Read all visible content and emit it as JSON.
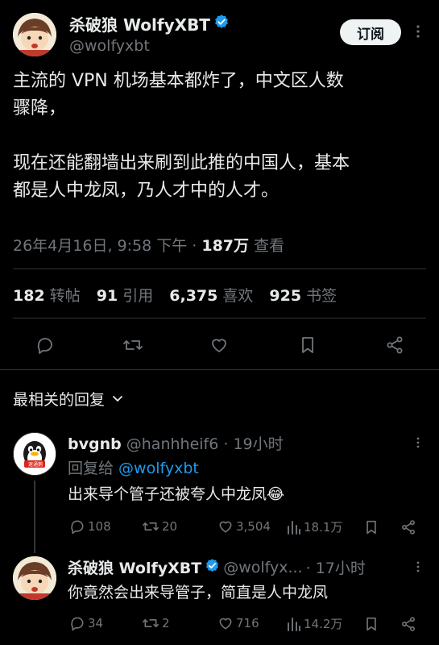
{
  "tweet": {
    "display_name": "杀破狼 WolfyXBT",
    "handle": "@wolfyxbt",
    "subscribe_label": "订阅",
    "more_icon": "more-dots-icon",
    "text_line1": "主流的 VPN 机场基本都炸了，中文区人数",
    "text_line2": "骤降，",
    "text_line3": "现在还能翻墙出来刷到此推的中国人，基本",
    "text_line4": "都是人中龙凤，乃人才中的人才。",
    "meta_time": "26年4月16日, 9:58 下午 · ",
    "meta_views": "187万",
    "meta_views_label": " 查看",
    "stats": {
      "retweets": "182",
      "retweets_label": "转帖",
      "quotes": "91",
      "quotes_label": "引用",
      "likes": "6,375",
      "likes_label": "喜欢",
      "bookmarks": "925",
      "bookmarks_label": "书签"
    }
  },
  "actions": [
    "reply-icon",
    "retweet-icon",
    "like-icon",
    "bookmark-icon",
    "share-icon"
  ],
  "sort": {
    "label": "最相关的回复"
  },
  "replies": [
    {
      "name": "bvgnb",
      "handle": "@hanhheif6",
      "time": " · 19小时",
      "reply_to_prefix": "回复给 ",
      "reply_to_handle": "@wolfyxbt",
      "text": "出来导个管子还被夸人中龙凤😂",
      "avatar_badge": "速通鹅",
      "replies_count": "108",
      "retweets_count": "20",
      "likes_count": "3,504",
      "views_count": "18.1万"
    },
    {
      "name": "杀破狼 WolfyXBT",
      "handle": "@wolfyx...",
      "time": " · 17小时",
      "text": "你竟然会出来导管子，简直是人中龙凤",
      "replies_count": "34",
      "retweets_count": "2",
      "likes_count": "716",
      "views_count": "14.2万"
    }
  ],
  "colors": {
    "background": "#000000",
    "text": "#e7e9ea",
    "muted": "#71767b",
    "link": "#1d9bf0",
    "divider": "#2f3336",
    "verified": "#1d9bf0"
  }
}
